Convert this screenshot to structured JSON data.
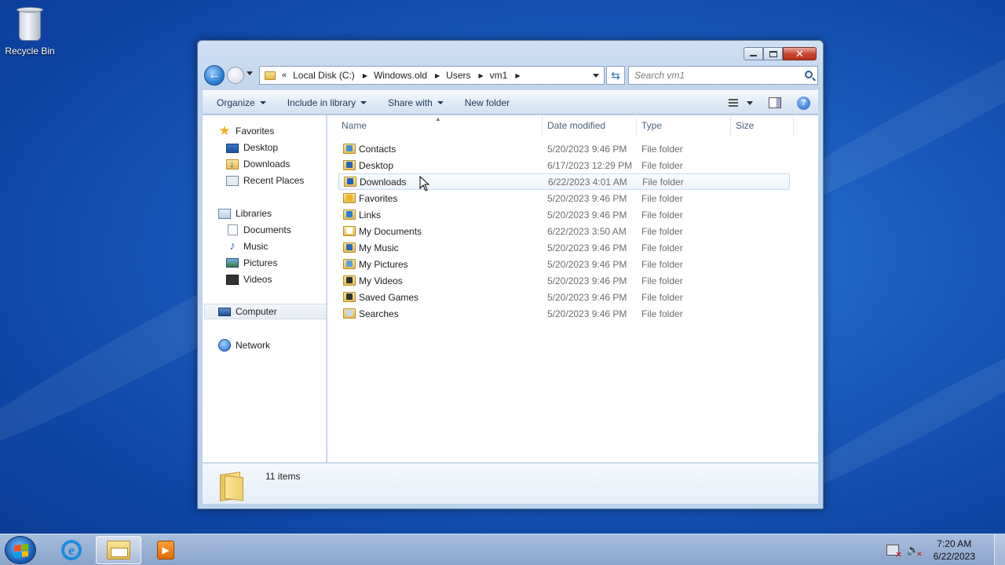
{
  "desktop": {
    "recycle_bin_label": "Recycle Bin"
  },
  "window": {
    "close_glyph": "✕",
    "address": {
      "overflow_glyph": "«",
      "crumbs": [
        "Local Disk (C:)",
        "Windows.old",
        "Users",
        "vm1"
      ]
    },
    "search": {
      "placeholder": "Search vm1"
    },
    "toolbar": {
      "organize": "Organize",
      "include_in_library": "Include in library",
      "share_with": "Share with",
      "new_folder": "New folder",
      "help_glyph": "?"
    },
    "nav": {
      "favorites": "Favorites",
      "desktop": "Desktop",
      "downloads": "Downloads",
      "recent_places": "Recent Places",
      "libraries": "Libraries",
      "documents": "Documents",
      "music": "Music",
      "pictures": "Pictures",
      "videos": "Videos",
      "computer": "Computer",
      "network": "Network"
    },
    "columns": {
      "name": "Name",
      "date_modified": "Date modified",
      "type": "Type",
      "size": "Size"
    },
    "files": [
      {
        "name": "Contacts",
        "date": "5/20/2023 9:46 PM",
        "type": "File folder"
      },
      {
        "name": "Desktop",
        "date": "6/17/2023 12:29 PM",
        "type": "File folder"
      },
      {
        "name": "Downloads",
        "date": "6/22/2023 4:01 AM",
        "type": "File folder"
      },
      {
        "name": "Favorites",
        "date": "5/20/2023 9:46 PM",
        "type": "File folder"
      },
      {
        "name": "Links",
        "date": "5/20/2023 9:46 PM",
        "type": "File folder"
      },
      {
        "name": "My Documents",
        "date": "6/22/2023 3:50 AM",
        "type": "File folder"
      },
      {
        "name": "My Music",
        "date": "5/20/2023 9:46 PM",
        "type": "File folder"
      },
      {
        "name": "My Pictures",
        "date": "5/20/2023 9:46 PM",
        "type": "File folder"
      },
      {
        "name": "My Videos",
        "date": "5/20/2023 9:46 PM",
        "type": "File folder"
      },
      {
        "name": "Saved Games",
        "date": "5/20/2023 9:46 PM",
        "type": "File folder"
      },
      {
        "name": "Searches",
        "date": "5/20/2023 9:46 PM",
        "type": "File folder"
      }
    ],
    "status": {
      "item_count": "11 items"
    }
  },
  "taskbar": {
    "clock_time": "7:20 AM",
    "clock_date": "6/22/2023",
    "ie_glyph": "e",
    "wmp_glyph": "▶"
  },
  "colors": {
    "desktop_blue": "#1a5fc0",
    "hover_row": "#eef4fb",
    "folder_yellow": "#e6bc52"
  }
}
